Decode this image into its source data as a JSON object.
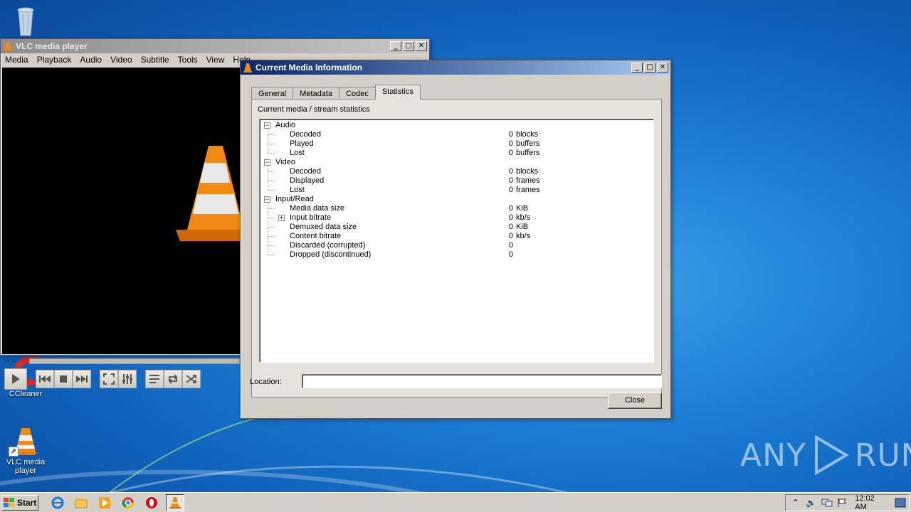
{
  "desktop": {
    "icons": [
      {
        "label": "",
        "icon": "recycle-bin-icon"
      },
      {
        "label": "CCleaner",
        "icon": "ccleaner-icon"
      },
      {
        "label": "VLC media\nplayer",
        "icon": "vlc-cone-icon"
      }
    ],
    "watermark": "ANY RUN"
  },
  "vlc_window": {
    "title": "VLC media player",
    "menu": [
      "Media",
      "Playback",
      "Audio",
      "Video",
      "Subtitle",
      "Tools",
      "View",
      "Help"
    ],
    "time": "--:--",
    "controls": [
      "play-icon",
      "previous-icon",
      "stop-icon",
      "next-icon",
      "fullscreen-icon",
      "extended-settings-icon",
      "playlist-icon",
      "loop-icon",
      "random-icon"
    ]
  },
  "media_info": {
    "title": "Current Media Information",
    "tabs": [
      "General",
      "Metadata",
      "Codec",
      "Statistics"
    ],
    "selected_tab": "Statistics",
    "caption": "Current media / stream statistics",
    "stats": [
      {
        "group": "Audio",
        "items": [
          {
            "label": "Decoded",
            "value": "0",
            "unit": "blocks"
          },
          {
            "label": "Played",
            "value": "0",
            "unit": "buffers"
          },
          {
            "label": "Lost",
            "value": "0",
            "unit": "buffers"
          }
        ]
      },
      {
        "group": "Video",
        "items": [
          {
            "label": "Decoded",
            "value": "0",
            "unit": "blocks"
          },
          {
            "label": "Displayed",
            "value": "0",
            "unit": "frames"
          },
          {
            "label": "Lost",
            "value": "0",
            "unit": "frames"
          }
        ]
      },
      {
        "group": "Input/Read",
        "items": [
          {
            "label": "Media data size",
            "value": "0",
            "unit": "KiB"
          },
          {
            "label": "Input bitrate",
            "value": "0",
            "unit": "kb/s",
            "expandable": true
          },
          {
            "label": "Demuxed data size",
            "value": "0",
            "unit": "KiB"
          },
          {
            "label": "Content bitrate",
            "value": "0",
            "unit": "kb/s"
          },
          {
            "label": "Discarded (corrupted)",
            "value": "0",
            "unit": ""
          },
          {
            "label": "Dropped (discontinued)",
            "value": "0",
            "unit": ""
          }
        ]
      }
    ],
    "location_label": "Location:",
    "location_value": "",
    "close_label": "Close"
  },
  "taskbar": {
    "start_label": "Start",
    "apps": [
      "ie-icon",
      "explorer-icon",
      "media-player-icon",
      "chrome-icon",
      "opera-icon",
      "vlc-taskbar-icon"
    ],
    "clock": "12:02 AM"
  }
}
